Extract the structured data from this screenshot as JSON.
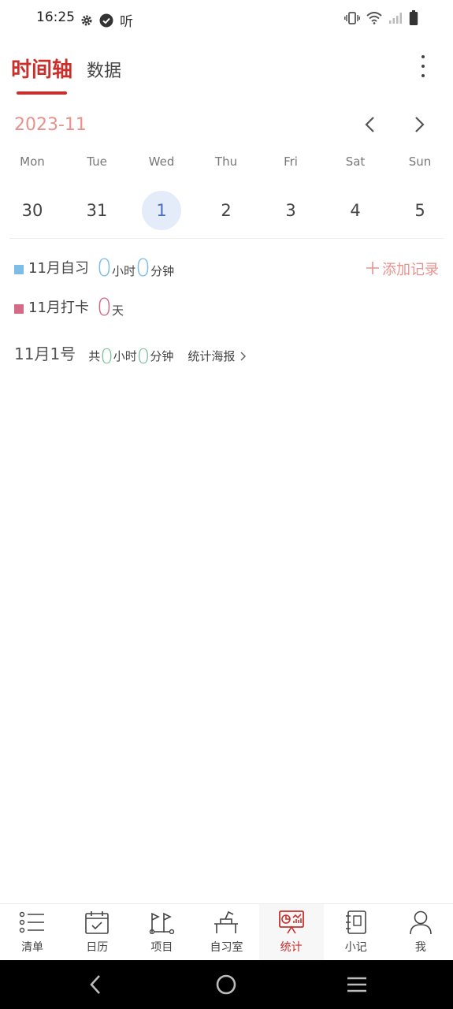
{
  "status_bar": {
    "time": "16:25",
    "left_icons": [
      "gear-icon",
      "check-circle-icon",
      "listen-icon"
    ],
    "listen_text": "听",
    "right_icons": [
      "vibrate-icon",
      "wifi-icon",
      "signal-icon",
      "battery-icon"
    ]
  },
  "header": {
    "tabs": [
      {
        "label": "时间轴",
        "active": true
      },
      {
        "label": "数据",
        "active": false
      }
    ]
  },
  "calendar": {
    "month": "2023-11",
    "weekdays": [
      "Mon",
      "Tue",
      "Wed",
      "Thu",
      "Fri",
      "Sat",
      "Sun"
    ],
    "dates": [
      "30",
      "31",
      "1",
      "2",
      "3",
      "4",
      "5"
    ],
    "selected_date": "1"
  },
  "stats": {
    "study": {
      "label": "11月自习",
      "hours": "0",
      "hours_unit": "小时",
      "minutes": "0",
      "minutes_unit": "分钟"
    },
    "checkin": {
      "label": "11月打卡",
      "days": "0",
      "days_unit": "天"
    },
    "add_record": "添加记录"
  },
  "day_summary": {
    "title": "11月1号",
    "total_prefix": "共",
    "hours": "0",
    "hours_unit": "小时",
    "minutes": "0",
    "minutes_unit": "分钟",
    "poster_link": "统计海报"
  },
  "bottom_nav": [
    {
      "label": "清单",
      "icon": "list-icon"
    },
    {
      "label": "日历",
      "icon": "calendar-icon"
    },
    {
      "label": "项目",
      "icon": "project-flag-icon"
    },
    {
      "label": "自习室",
      "icon": "study-room-icon"
    },
    {
      "label": "统计",
      "icon": "statistics-icon",
      "active": true
    },
    {
      "label": "小记",
      "icon": "notebook-icon"
    },
    {
      "label": "我",
      "icon": "profile-icon"
    }
  ],
  "colors": {
    "accent": "#c9302c",
    "month": "#e8928d",
    "study": "#7cbde8",
    "checkin": "#d56a87",
    "total": "#7bbf9c",
    "selected_date_bg": "#e4ebf9"
  }
}
